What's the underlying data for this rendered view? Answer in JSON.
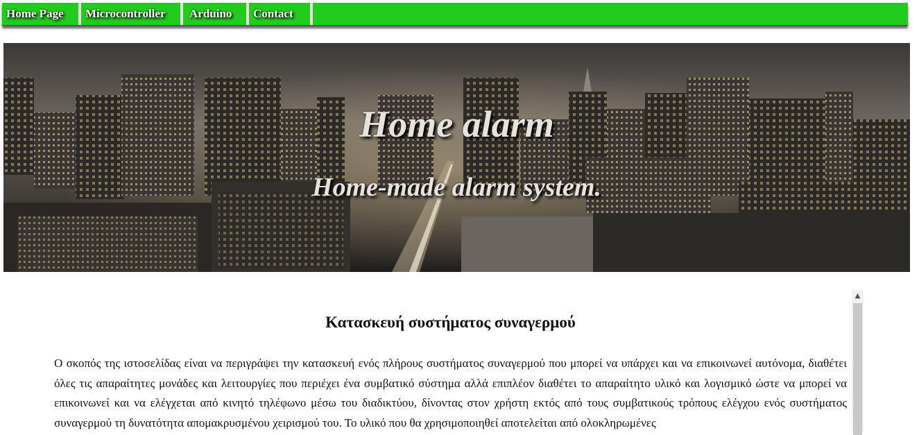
{
  "nav": {
    "items": [
      {
        "label": "Home Page"
      },
      {
        "label": "Microcontroller"
      },
      {
        "label": "Arduino"
      },
      {
        "label": "Contact"
      }
    ],
    "color": "#22cc1d"
  },
  "banner": {
    "title": "Home alarm",
    "subtitle": "Home-made alarm system."
  },
  "article": {
    "heading": "Κατασκευή συστήματος συναγερμού",
    "body": "Ο σκοπός της ιστοσελίδας είναι να περιγράψει την κατασκευή ενός πλήρους συστήματος συναγερμού που μπορεί να υπάρχει και να επικοινωνεί αυτόνομα, διαθέτει όλες τις απαραίτητες μονάδες και λειτουργίες που περιέχει ένα συμβατικό σύστημα αλλά επιπλέον διαθέτει το απαραίτητο υλικό και λογισμικό ώστε να μπορεί να επικοινωνεί και να ελέγχεται από κινητό τηλέφωνο μέσω του διαδικτύου, δίνοντας στον χρήστη εκτός από τους συμβατικούς τρόπους ελέγχου ενός συστήματος συναγερμού τη δυνατότητα απομακρυσμένου χειρισμού του. Το υλικό που θα χρησιμοποιηθεί αποτελείται από ολοκληρωμένες"
  },
  "icons": {
    "scroll_up": "chevron-up-icon"
  }
}
